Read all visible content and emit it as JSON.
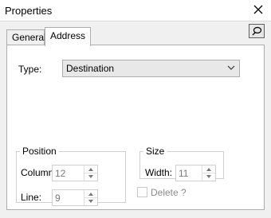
{
  "window": {
    "title": "Properties"
  },
  "tabs": [
    {
      "label": "General",
      "active": false
    },
    {
      "label": "Address",
      "active": true
    }
  ],
  "type": {
    "label": "Type:",
    "selected": "Destination"
  },
  "position": {
    "legend": "Position",
    "column_label": "Column:",
    "column_value": "12",
    "line_label": "Line:",
    "line_value": "9"
  },
  "size": {
    "legend": "Size",
    "width_label": "Width:",
    "width_value": "11"
  },
  "delete": {
    "label": "Delete ?",
    "checked": false,
    "enabled": false
  }
}
